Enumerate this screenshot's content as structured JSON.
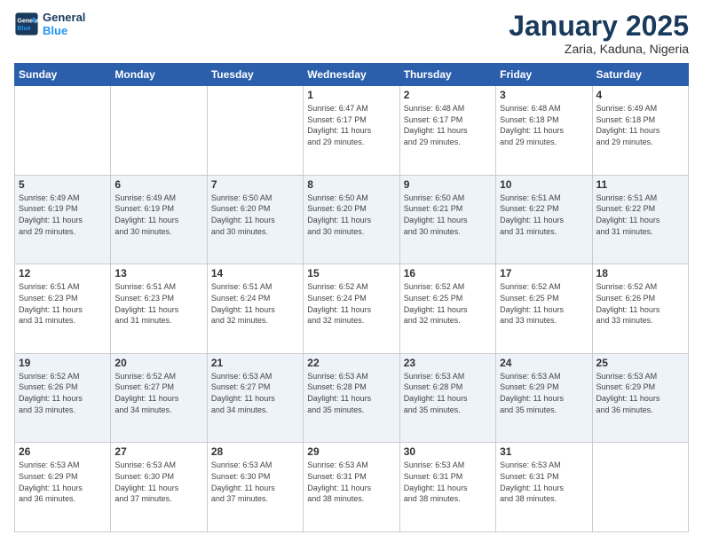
{
  "logo": {
    "line1": "General",
    "line2": "Blue"
  },
  "title": "January 2025",
  "subtitle": "Zaria, Kaduna, Nigeria",
  "days_of_week": [
    "Sunday",
    "Monday",
    "Tuesday",
    "Wednesday",
    "Thursday",
    "Friday",
    "Saturday"
  ],
  "weeks": [
    [
      {
        "num": "",
        "info": ""
      },
      {
        "num": "",
        "info": ""
      },
      {
        "num": "",
        "info": ""
      },
      {
        "num": "1",
        "info": "Sunrise: 6:47 AM\nSunset: 6:17 PM\nDaylight: 11 hours\nand 29 minutes."
      },
      {
        "num": "2",
        "info": "Sunrise: 6:48 AM\nSunset: 6:17 PM\nDaylight: 11 hours\nand 29 minutes."
      },
      {
        "num": "3",
        "info": "Sunrise: 6:48 AM\nSunset: 6:18 PM\nDaylight: 11 hours\nand 29 minutes."
      },
      {
        "num": "4",
        "info": "Sunrise: 6:49 AM\nSunset: 6:18 PM\nDaylight: 11 hours\nand 29 minutes."
      }
    ],
    [
      {
        "num": "5",
        "info": "Sunrise: 6:49 AM\nSunset: 6:19 PM\nDaylight: 11 hours\nand 29 minutes."
      },
      {
        "num": "6",
        "info": "Sunrise: 6:49 AM\nSunset: 6:19 PM\nDaylight: 11 hours\nand 30 minutes."
      },
      {
        "num": "7",
        "info": "Sunrise: 6:50 AM\nSunset: 6:20 PM\nDaylight: 11 hours\nand 30 minutes."
      },
      {
        "num": "8",
        "info": "Sunrise: 6:50 AM\nSunset: 6:20 PM\nDaylight: 11 hours\nand 30 minutes."
      },
      {
        "num": "9",
        "info": "Sunrise: 6:50 AM\nSunset: 6:21 PM\nDaylight: 11 hours\nand 30 minutes."
      },
      {
        "num": "10",
        "info": "Sunrise: 6:51 AM\nSunset: 6:22 PM\nDaylight: 11 hours\nand 31 minutes."
      },
      {
        "num": "11",
        "info": "Sunrise: 6:51 AM\nSunset: 6:22 PM\nDaylight: 11 hours\nand 31 minutes."
      }
    ],
    [
      {
        "num": "12",
        "info": "Sunrise: 6:51 AM\nSunset: 6:23 PM\nDaylight: 11 hours\nand 31 minutes."
      },
      {
        "num": "13",
        "info": "Sunrise: 6:51 AM\nSunset: 6:23 PM\nDaylight: 11 hours\nand 31 minutes."
      },
      {
        "num": "14",
        "info": "Sunrise: 6:51 AM\nSunset: 6:24 PM\nDaylight: 11 hours\nand 32 minutes."
      },
      {
        "num": "15",
        "info": "Sunrise: 6:52 AM\nSunset: 6:24 PM\nDaylight: 11 hours\nand 32 minutes."
      },
      {
        "num": "16",
        "info": "Sunrise: 6:52 AM\nSunset: 6:25 PM\nDaylight: 11 hours\nand 32 minutes."
      },
      {
        "num": "17",
        "info": "Sunrise: 6:52 AM\nSunset: 6:25 PM\nDaylight: 11 hours\nand 33 minutes."
      },
      {
        "num": "18",
        "info": "Sunrise: 6:52 AM\nSunset: 6:26 PM\nDaylight: 11 hours\nand 33 minutes."
      }
    ],
    [
      {
        "num": "19",
        "info": "Sunrise: 6:52 AM\nSunset: 6:26 PM\nDaylight: 11 hours\nand 33 minutes."
      },
      {
        "num": "20",
        "info": "Sunrise: 6:52 AM\nSunset: 6:27 PM\nDaylight: 11 hours\nand 34 minutes."
      },
      {
        "num": "21",
        "info": "Sunrise: 6:53 AM\nSunset: 6:27 PM\nDaylight: 11 hours\nand 34 minutes."
      },
      {
        "num": "22",
        "info": "Sunrise: 6:53 AM\nSunset: 6:28 PM\nDaylight: 11 hours\nand 35 minutes."
      },
      {
        "num": "23",
        "info": "Sunrise: 6:53 AM\nSunset: 6:28 PM\nDaylight: 11 hours\nand 35 minutes."
      },
      {
        "num": "24",
        "info": "Sunrise: 6:53 AM\nSunset: 6:29 PM\nDaylight: 11 hours\nand 35 minutes."
      },
      {
        "num": "25",
        "info": "Sunrise: 6:53 AM\nSunset: 6:29 PM\nDaylight: 11 hours\nand 36 minutes."
      }
    ],
    [
      {
        "num": "26",
        "info": "Sunrise: 6:53 AM\nSunset: 6:29 PM\nDaylight: 11 hours\nand 36 minutes."
      },
      {
        "num": "27",
        "info": "Sunrise: 6:53 AM\nSunset: 6:30 PM\nDaylight: 11 hours\nand 37 minutes."
      },
      {
        "num": "28",
        "info": "Sunrise: 6:53 AM\nSunset: 6:30 PM\nDaylight: 11 hours\nand 37 minutes."
      },
      {
        "num": "29",
        "info": "Sunrise: 6:53 AM\nSunset: 6:31 PM\nDaylight: 11 hours\nand 38 minutes."
      },
      {
        "num": "30",
        "info": "Sunrise: 6:53 AM\nSunset: 6:31 PM\nDaylight: 11 hours\nand 38 minutes."
      },
      {
        "num": "31",
        "info": "Sunrise: 6:53 AM\nSunset: 6:31 PM\nDaylight: 11 hours\nand 38 minutes."
      },
      {
        "num": "",
        "info": ""
      }
    ]
  ]
}
